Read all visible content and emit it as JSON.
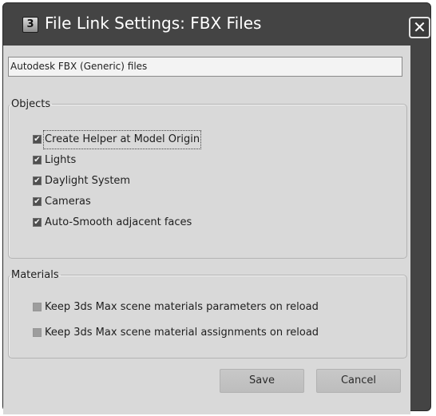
{
  "window": {
    "icon_glyph": "3",
    "title": "File Link Settings: FBX Files",
    "close_glyph": "✕"
  },
  "description": "Autodesk FBX (Generic) files",
  "objects": {
    "legend": "Objects",
    "options": [
      {
        "label": "Create Helper at Model Origin",
        "checked": true
      },
      {
        "label": "Lights",
        "checked": true
      },
      {
        "label": "Daylight System",
        "checked": true
      },
      {
        "label": "Cameras",
        "checked": true
      },
      {
        "label": "Auto-Smooth adjacent faces",
        "checked": true
      }
    ]
  },
  "materials": {
    "legend": "Materials",
    "options": [
      {
        "label": "Keep 3ds Max scene materials parameters on reload",
        "checked": false
      },
      {
        "label": "Keep 3ds Max scene material assignments on reload",
        "checked": false
      }
    ]
  },
  "buttons": {
    "save": "Save",
    "cancel": "Cancel"
  },
  "check_glyph": "✔",
  "colors": {
    "title_bar": "#444444",
    "dialog_body": "#d9d9d9"
  }
}
